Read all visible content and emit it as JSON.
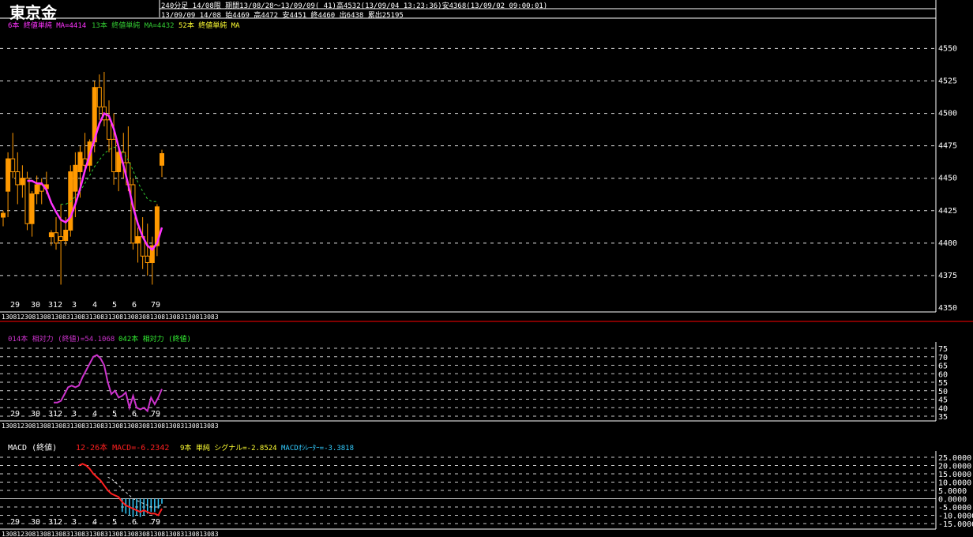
{
  "header": {
    "title": "東京金",
    "line1": "240分足 14/08限 期間13/08/28～13/09/09( 41)高4532(13/09/04 13:23:36)安4368(13/09/02 09:00:01)",
    "line2": "13/09/09 14/08 始4469 高4472 安4451 終4460 出6438 累出25195"
  },
  "colors": {
    "up": "#ff9900",
    "ma6": "#ff33ff",
    "ma13": "#33cc33",
    "rsi14": "#cc33cc",
    "macd": "#ff2020",
    "signal": "#dddddd",
    "osc": "#33ccff",
    "separator": "#aa0000"
  },
  "x_labels": [
    "29",
    "30",
    "31",
    "2",
    "3",
    "4",
    "5",
    "6",
    "7",
    "9"
  ],
  "date_strip": "130812308130813083130831308313081308308130813083130813083",
  "chart_data": [
    {
      "type": "candlestick",
      "legend": [
        "6本 終値単純 MA=4414",
        "13本 終値単純 MA=4432",
        "52本 終値単純 MA"
      ],
      "ylim": [
        4350,
        4560
      ],
      "y_ticks": [
        4550,
        4525,
        4500,
        4475,
        4450,
        4425,
        4400,
        4375,
        4350
      ],
      "candles": [
        {
          "o": 4420,
          "h": 4425,
          "l": 4413,
          "c": 4423
        },
        {
          "o": 4440,
          "h": 4470,
          "l": 4420,
          "c": 4465
        },
        {
          "o": 4465,
          "h": 4485,
          "l": 4450,
          "c": 4455
        },
        {
          "o": 4455,
          "h": 4470,
          "l": 4430,
          "c": 4445
        },
        {
          "o": 4445,
          "h": 4460,
          "l": 4435,
          "c": 4450
        },
        {
          "o": 4450,
          "h": 4455,
          "l": 4410,
          "c": 4415
        },
        {
          "o": 4415,
          "h": 4440,
          "l": 4405,
          "c": 4438
        },
        {
          "o": 4438,
          "h": 4452,
          "l": 4430,
          "c": 4445
        },
        {
          "o": 4445,
          "h": 4450,
          "l": 4430,
          "c": 4440
        },
        {
          "o": 4442,
          "h": 4455,
          "l": 4438,
          "c": 4445
        },
        {
          "o": 4405,
          "h": 4410,
          "l": 4398,
          "c": 4408
        },
        {
          "o": 4408,
          "h": 4420,
          "l": 4395,
          "c": 4400
        },
        {
          "o": 4405,
          "h": 4430,
          "l": 4368,
          "c": 4402
        },
        {
          "o": 4402,
          "h": 4420,
          "l": 4398,
          "c": 4410
        },
        {
          "o": 4410,
          "h": 4460,
          "l": 4405,
          "c": 4455
        },
        {
          "o": 4440,
          "h": 4470,
          "l": 4420,
          "c": 4460
        },
        {
          "o": 4455,
          "h": 4475,
          "l": 4435,
          "c": 4470
        },
        {
          "o": 4465,
          "h": 4485,
          "l": 4455,
          "c": 4460
        },
        {
          "o": 4460,
          "h": 4480,
          "l": 4455,
          "c": 4478
        },
        {
          "o": 4478,
          "h": 4525,
          "l": 4470,
          "c": 4520
        },
        {
          "o": 4520,
          "h": 4530,
          "l": 4495,
          "c": 4505
        },
        {
          "o": 4505,
          "h": 4532,
          "l": 4490,
          "c": 4495
        },
        {
          "o": 4495,
          "h": 4510,
          "l": 4470,
          "c": 4480
        },
        {
          "o": 4480,
          "h": 4500,
          "l": 4445,
          "c": 4455
        },
        {
          "o": 4455,
          "h": 4475,
          "l": 4440,
          "c": 4470
        },
        {
          "o": 4470,
          "h": 4485,
          "l": 4450,
          "c": 4462
        },
        {
          "o": 4462,
          "h": 4490,
          "l": 4440,
          "c": 4445
        },
        {
          "o": 4445,
          "h": 4450,
          "l": 4395,
          "c": 4400
        },
        {
          "o": 4400,
          "h": 4412,
          "l": 4385,
          "c": 4405
        },
        {
          "o": 4405,
          "h": 4420,
          "l": 4380,
          "c": 4390
        },
        {
          "o": 4390,
          "h": 4415,
          "l": 4375,
          "c": 4385
        },
        {
          "o": 4385,
          "h": 4405,
          "l": 4368,
          "c": 4398
        },
        {
          "o": 4398,
          "h": 4430,
          "l": 4390,
          "c": 4428
        },
        {
          "o": 4460,
          "h": 4472,
          "l": 4451,
          "c": 4469
        }
      ],
      "ma6": [
        null,
        null,
        null,
        null,
        null,
        4448,
        4448,
        4446,
        4446,
        4441,
        4431,
        4424,
        4418,
        4416,
        4420,
        4430,
        4442,
        4456,
        4468,
        4480,
        4492,
        4500,
        4498,
        4488,
        4474,
        4460,
        4445,
        4428,
        4415,
        4405,
        4398,
        4395,
        4400,
        4412
      ],
      "ma13": [
        null,
        null,
        null,
        null,
        null,
        null,
        null,
        null,
        null,
        null,
        null,
        null,
        4430,
        4430,
        4432,
        4436,
        4440,
        4446,
        4452,
        4459,
        4464,
        4469,
        4472,
        4474,
        4473,
        4470,
        4464,
        4456,
        4447,
        4440,
        4434,
        4432,
        4432
      ]
    },
    {
      "type": "line",
      "legend": [
        "014本 相対力 (終値)=54.1068",
        "042本 相対力 (終値)"
      ],
      "ylim": [
        35,
        75
      ],
      "y_ticks": [
        75,
        70,
        65,
        60,
        55,
        50,
        45,
        40,
        35
      ],
      "rsi14": [
        null,
        null,
        null,
        null,
        null,
        null,
        null,
        null,
        null,
        null,
        null,
        null,
        null,
        null,
        43,
        43,
        44,
        48,
        52,
        53,
        52,
        53,
        58,
        62,
        66,
        70,
        71,
        69,
        65,
        55,
        48,
        50,
        46,
        47,
        49,
        40,
        47,
        40,
        39,
        40,
        38,
        46,
        42,
        46,
        51
      ]
    },
    {
      "type": "macd",
      "legend": [
        "MACD (終値)",
        "12-26本 MACD=-6.2342",
        "9本 単純 シグナル=-2.8524",
        "MACDｵｼﾚｰﾀｰ=-3.3818"
      ],
      "ylim": [
        -15,
        25
      ],
      "y_ticks": [
        "25.0000",
        "20.0000",
        "15.0000",
        "10.0000",
        "5.0000",
        "0.0000",
        "-5.0000",
        "-10.0000",
        "-15.0000"
      ],
      "macd": [
        null,
        null,
        null,
        null,
        null,
        null,
        null,
        null,
        null,
        null,
        null,
        null,
        null,
        null,
        null,
        null,
        null,
        null,
        null,
        null,
        null,
        20,
        21,
        20,
        18,
        15,
        13,
        11,
        8,
        5,
        3,
        2,
        1,
        -2,
        -4,
        -5,
        -6,
        -7,
        -8,
        -7,
        -8,
        -9,
        -9,
        -10,
        -6
      ],
      "signal": [
        null,
        null,
        null,
        null,
        null,
        null,
        null,
        null,
        null,
        null,
        null,
        null,
        null,
        null,
        null,
        null,
        null,
        null,
        null,
        null,
        null,
        null,
        null,
        null,
        null,
        null,
        null,
        null,
        null,
        13,
        12,
        10,
        8,
        6,
        4,
        2,
        0,
        -1,
        -2,
        -3,
        -4,
        -5,
        -5,
        -5,
        -3
      ],
      "osc": [
        null,
        null,
        null,
        null,
        null,
        null,
        null,
        null,
        null,
        null,
        null,
        null,
        null,
        null,
        null,
        null,
        null,
        null,
        null,
        null,
        null,
        null,
        null,
        null,
        null,
        null,
        null,
        null,
        null,
        null,
        null,
        null,
        null,
        -8,
        -9,
        -10,
        -11,
        -10,
        -11,
        -10,
        -9,
        -8,
        -8,
        -6,
        -3
      ]
    }
  ]
}
